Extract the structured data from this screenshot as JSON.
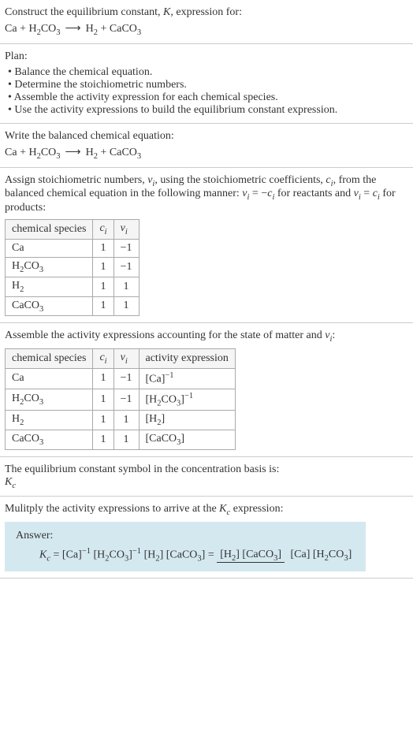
{
  "section1": {
    "title": "Construct the equilibrium constant, ",
    "k": "K",
    "title2": ", expression for:",
    "eq_lhs1": "Ca",
    "eq_plus": " + ",
    "eq_lhs2": "H",
    "eq_lhs2_sub": "2",
    "eq_lhs3": "CO",
    "eq_lhs3_sub": "3",
    "arrow": "⟶",
    "eq_rhs1": "H",
    "eq_rhs1_sub": "2",
    "eq_rhs2": "CaCO",
    "eq_rhs2_sub": "3"
  },
  "section2": {
    "title": "Plan:",
    "bullets": [
      "• Balance the chemical equation.",
      "• Determine the stoichiometric numbers.",
      "• Assemble the activity expression for each chemical species.",
      "• Use the activity expressions to build the equilibrium constant expression."
    ]
  },
  "section3": {
    "title": "Write the balanced chemical equation:"
  },
  "section4": {
    "text1": "Assign stoichiometric numbers, ",
    "nu_i": "ν",
    "sub_i": "i",
    "text2": ", using the stoichiometric coefficients, ",
    "c_i": "c",
    "text3": ", from the balanced chemical equation in the following manner: ",
    "nu_eq": "ν",
    "eq_neg": " = −",
    "text4": " for reactants and ",
    "eq_pos": " = ",
    "text5": " for products:",
    "headers": {
      "species": "chemical species",
      "ci": "c",
      "ci_sub": "i",
      "nui": "ν",
      "nui_sub": "i"
    },
    "rows": [
      {
        "species": "Ca",
        "sub": "",
        "ci": "1",
        "nui": "−1"
      },
      {
        "species": "H",
        "sub": "2",
        "species2": "CO",
        "sub2": "3",
        "ci": "1",
        "nui": "−1"
      },
      {
        "species": "H",
        "sub": "2",
        "species2": "",
        "sub2": "",
        "ci": "1",
        "nui": "1"
      },
      {
        "species": "CaCO",
        "sub": "3",
        "species2": "",
        "sub2": "",
        "ci": "1",
        "nui": "1"
      }
    ]
  },
  "section5": {
    "text1": "Assemble the activity expressions accounting for the state of matter and ",
    "nu": "ν",
    "sub_i": "i",
    "text2": ":",
    "headers": {
      "species": "chemical species",
      "ci": "c",
      "ci_sub": "i",
      "nui": "ν",
      "nui_sub": "i",
      "activity": "activity expression"
    },
    "rows": [
      {
        "s1": "Ca",
        "sub1": "",
        "s2": "",
        "sub2": "",
        "ci": "1",
        "nui": "−1",
        "a1": "[Ca]",
        "asup": "−1",
        "a2": ""
      },
      {
        "s1": "H",
        "sub1": "2",
        "s2": "CO",
        "sub2": "3",
        "ci": "1",
        "nui": "−1",
        "a1": "[H",
        "asub1": "2",
        "a1b": "CO",
        "asub2": "3",
        "a1c": "]",
        "asup": "−1"
      },
      {
        "s1": "H",
        "sub1": "2",
        "s2": "",
        "sub2": "",
        "ci": "1",
        "nui": "1",
        "a1": "[H",
        "asub1": "2",
        "a1c": "]"
      },
      {
        "s1": "CaCO",
        "sub1": "3",
        "s2": "",
        "sub2": "",
        "ci": "1",
        "nui": "1",
        "a1": "[CaCO",
        "asub1": "3",
        "a1c": "]"
      }
    ]
  },
  "section6": {
    "text": "The equilibrium constant symbol in the concentration basis is:",
    "kc": "K",
    "kc_sub": "c"
  },
  "section7": {
    "text1": "Mulitply the activity expressions to arrive at the ",
    "kc": "K",
    "kc_sub": "c",
    "text2": " expression:",
    "answer": "Answer:",
    "eq_label": "K",
    "eq_label_sub": "c",
    "eq_eq": " = ",
    "term1": "[Ca]",
    "term1_sup": "−1",
    "term2": " [H",
    "term2_sub": "2",
    "term2b": "CO",
    "term2_sub2": "3",
    "term2c": "]",
    "term2_sup": "−1",
    "term3": " [H",
    "term3_sub": "2",
    "term3b": "] [CaCO",
    "term3_sub2": "3",
    "term3c": "] = ",
    "frac_top1": "[H",
    "frac_top1_sub": "2",
    "frac_top2": "] [CaCO",
    "frac_top2_sub": "3",
    "frac_top3": "]",
    "frac_bot1": "[Ca] [H",
    "frac_bot1_sub": "2",
    "frac_bot2": "CO",
    "frac_bot2_sub": "3",
    "frac_bot3": "]"
  }
}
